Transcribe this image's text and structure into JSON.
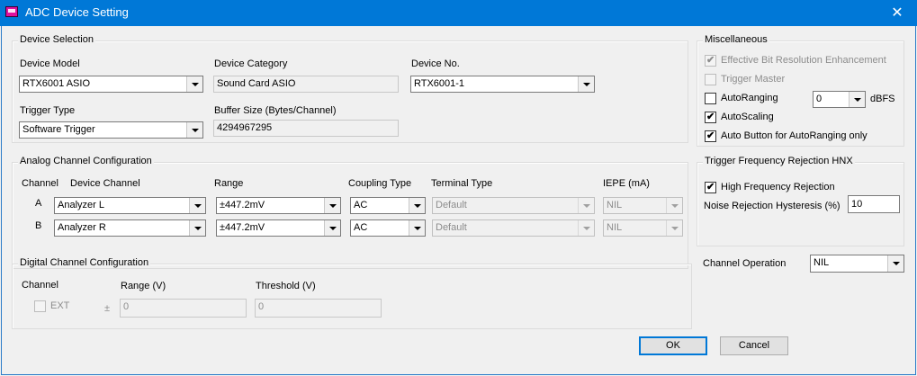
{
  "window": {
    "title": "ADC Device Setting",
    "close_glyph": "✕"
  },
  "device_selection": {
    "title": "Device Selection",
    "device_model": {
      "label": "Device Model",
      "value": "RTX6001 ASIO"
    },
    "device_category": {
      "label": "Device Category",
      "value": "Sound Card ASIO"
    },
    "device_no": {
      "label": "Device No.",
      "value": "RTX6001-1"
    },
    "trigger_type": {
      "label": "Trigger Type",
      "value": "Software Trigger"
    },
    "buffer_size": {
      "label": "Buffer Size (Bytes/Channel)",
      "value": "4294967295"
    }
  },
  "miscellaneous": {
    "title": "Miscellaneous",
    "effective_bit": {
      "label": "Effective Bit Resolution Enhancement",
      "checked": true
    },
    "trigger_master": {
      "label": "Trigger Master",
      "checked": false
    },
    "auto_ranging": {
      "label": "AutoRanging",
      "checked": false,
      "value": "0",
      "unit": "dBFS"
    },
    "auto_scaling": {
      "label": "AutoScaling",
      "checked": true
    },
    "auto_button": {
      "label": "Auto Button for AutoRanging only",
      "checked": true
    }
  },
  "analog": {
    "title": "Analog Channel Configuration",
    "headers": {
      "channel": "Channel",
      "device_channel": "Device Channel",
      "range": "Range",
      "coupling": "Coupling Type",
      "terminal": "Terminal Type",
      "iepe": "IEPE (mA)"
    },
    "rows": [
      {
        "channel": "A",
        "device_channel": "Analyzer L",
        "range": "±447.2mV",
        "coupling": "AC",
        "terminal": "Default",
        "iepe": "NIL"
      },
      {
        "channel": "B",
        "device_channel": "Analyzer R",
        "range": "±447.2mV",
        "coupling": "AC",
        "terminal": "Default",
        "iepe": "NIL"
      }
    ]
  },
  "trigger_rejection": {
    "title": "Trigger Frequency Rejection HNX",
    "high_freq": {
      "label": "High Frequency Rejection",
      "checked": true
    },
    "hysteresis": {
      "label": "Noise Rejection Hysteresis (%)",
      "value": "10"
    }
  },
  "digital": {
    "title": "Digital Channel Configuration",
    "channel_label": "Channel",
    "ext": {
      "label": "EXT",
      "checked": false
    },
    "range": {
      "label": "Range (V)",
      "prefix": "±",
      "value": "0"
    },
    "threshold": {
      "label": "Threshold (V)",
      "value": "0"
    }
  },
  "channel_operation": {
    "label": "Channel Operation",
    "value": "NIL"
  },
  "buttons": {
    "ok": "OK",
    "cancel": "Cancel"
  },
  "check_glyph": "✔"
}
